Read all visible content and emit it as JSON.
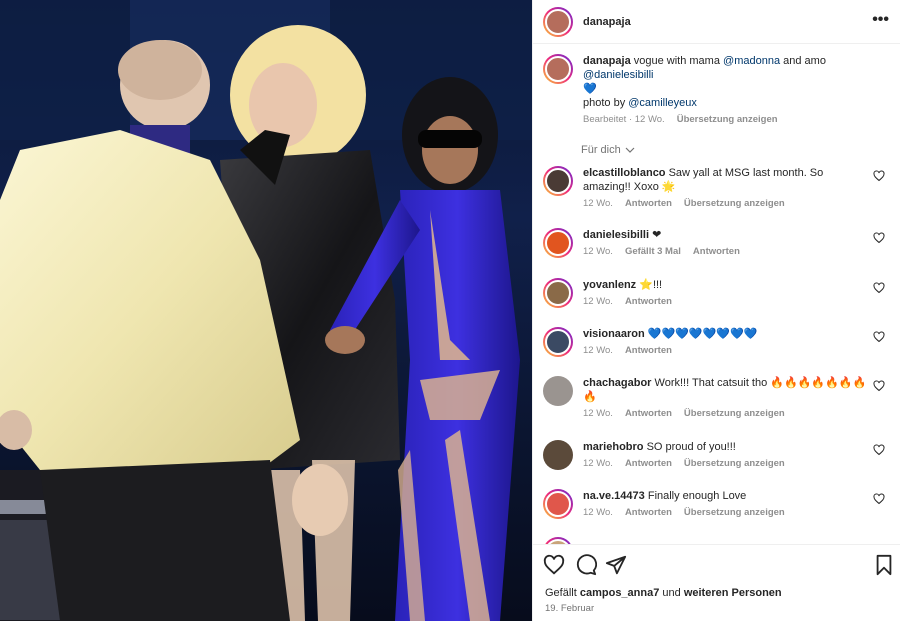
{
  "post": {
    "author": "danapaja"
  },
  "caption": {
    "username": "danapaja",
    "text_before": "vogue with mama",
    "mention1": "@madonna",
    "text_mid": "and amo",
    "mention2": "@danielesibilli",
    "emoji": "💙",
    "photo_by_label": "photo by",
    "mention3": "@camilleyeux",
    "edited": "Bearbeitet",
    "age": "12 Wo.",
    "translate": "Übersetzung anzeigen"
  },
  "filter": {
    "label": "Für dich"
  },
  "comments": [
    {
      "user": "elcastilloblanco",
      "text": "Saw yall at MSG last month. So amazing!! Xoxo 🌟",
      "age": "12 Wo.",
      "reply": "Antworten",
      "translate": "Übersetzung anzeigen",
      "likes": ""
    },
    {
      "user": "danielesibilli",
      "text": "❤",
      "age": "12 Wo.",
      "likes": "Gefällt 3 Mal",
      "reply": "Antworten",
      "translate": ""
    },
    {
      "user": "yovanlenz",
      "text": "⭐!!!",
      "age": "12 Wo.",
      "reply": "Antworten",
      "translate": "",
      "likes": ""
    },
    {
      "user": "visionaaron",
      "text": "💙💙💙💙💙💙💙💙",
      "age": "12 Wo.",
      "reply": "Antworten",
      "translate": "",
      "likes": ""
    },
    {
      "user": "chachagabor",
      "text": "Work!!! That catsuit tho 🔥🔥🔥🔥🔥🔥🔥🔥",
      "age": "12 Wo.",
      "reply": "Antworten",
      "translate": "Übersetzung anzeigen",
      "likes": ""
    },
    {
      "user": "mariehobro",
      "text": "SO proud of you!!!",
      "age": "12 Wo.",
      "reply": "Antworten",
      "translate": "Übersetzung anzeigen",
      "likes": ""
    },
    {
      "user": "na.ve.14473",
      "text": "Finally enough Love",
      "age": "12 Wo.",
      "reply": "Antworten",
      "translate": "Übersetzung anzeigen",
      "likes": ""
    }
  ],
  "footer": {
    "likes_prefix": "Gefällt",
    "likes_user": "campos_anna7",
    "likes_mid": "und",
    "likes_suffix": "weiteren Personen",
    "date": "19. Februar"
  },
  "icons": {
    "more": "more-dots-icon",
    "like": "heart-icon",
    "comment": "comment-icon",
    "share": "share-icon",
    "save": "bookmark-icon"
  },
  "colors": {
    "link": "#00376b",
    "muted": "#737373",
    "story_ring": [
      "#f9ce34",
      "#ee2a7b",
      "#6228d7"
    ]
  }
}
